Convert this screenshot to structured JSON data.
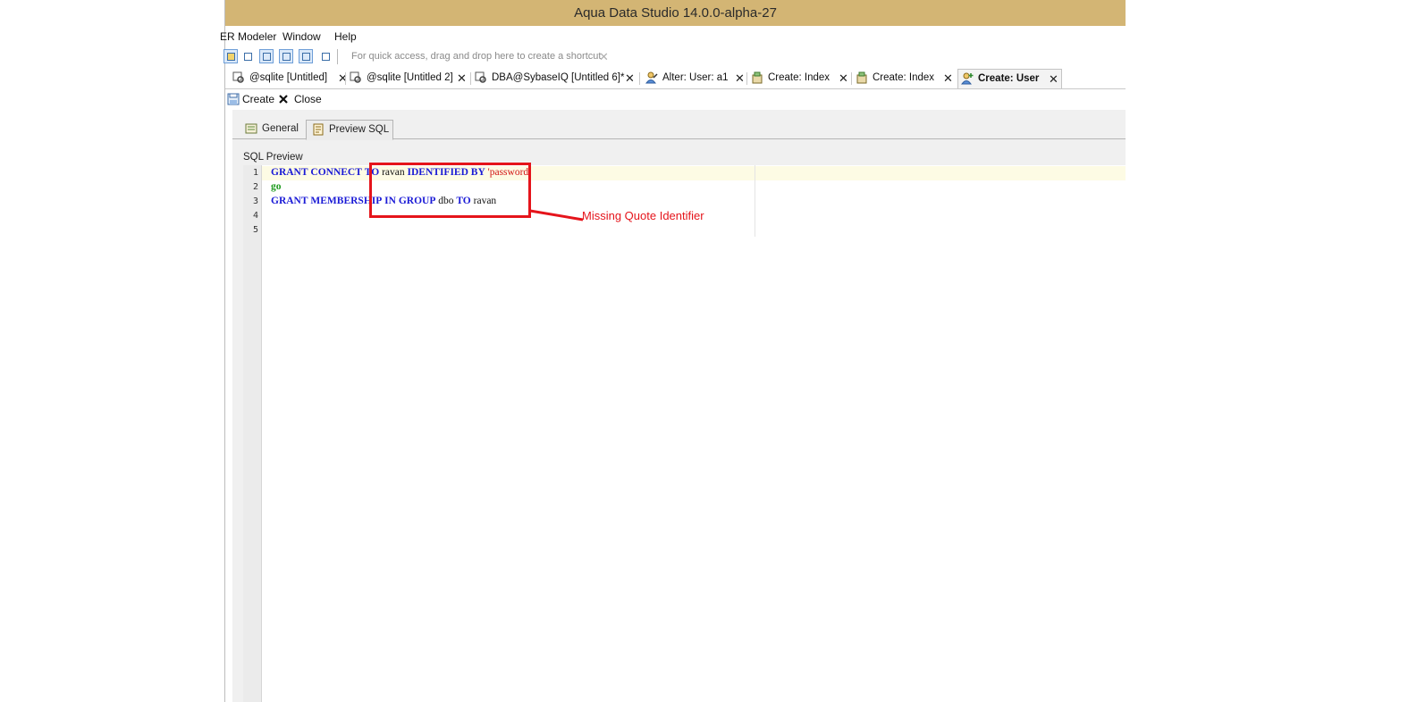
{
  "window": {
    "title": "Aqua Data Studio 14.0.0-alpha-27"
  },
  "menu": {
    "items": [
      "ER Modeler",
      "Window",
      "Help"
    ]
  },
  "toolbar": {
    "shortcut_hint": "For quick access, drag and drop here to create a shortcut",
    "hint_close": "✕"
  },
  "tabs": [
    {
      "label": "@sqlite [Untitled]",
      "icon": "query-icon",
      "close": "✕"
    },
    {
      "label": "@sqlite [Untitled 2]",
      "icon": "query-icon",
      "close": "✕"
    },
    {
      "label": "DBA@SybaseIQ [Untitled 6]*",
      "icon": "query-icon",
      "close": "✕"
    },
    {
      "label": "Alter: User: a1",
      "icon": "user-icon",
      "close": "✕"
    },
    {
      "label": "Create: Index",
      "icon": "index-icon",
      "close": "✕"
    },
    {
      "label": "Create: Index",
      "icon": "index-icon",
      "close": "✕"
    },
    {
      "label": "Create: User",
      "icon": "add-user-icon",
      "close": "✕",
      "active": true
    }
  ],
  "actions": {
    "create": "Create",
    "close": "Close"
  },
  "subtabs": {
    "general": "General",
    "preview_sql": "Preview SQL",
    "active": "preview_sql"
  },
  "preview": {
    "section_label": "SQL Preview",
    "line_numbers": [
      "1",
      "2",
      "3",
      "4",
      "5"
    ],
    "line1": {
      "kw1": "GRANT",
      "kw2": "CONNECT",
      "kw3": "TO",
      "user": "ravan",
      "kw4": "IDENTIFIED",
      "kw5": "BY",
      "pwd": "'password'"
    },
    "line2": {
      "kw": "go"
    },
    "line3": {
      "kw1": "GRANT",
      "kw2": "MEMBERSHIP",
      "kw3": "IN",
      "kw4": "GROUP",
      "grp": "dbo",
      "kw5": "TO",
      "user": "ravan"
    }
  },
  "annotation": {
    "text": "Missing Quote Identifier",
    "color": "#e5141b"
  },
  "colors": {
    "titlebar": "#d3b574",
    "keyword": "#1a1ad6",
    "string": "#d21414",
    "go_keyword": "#1d9a1d"
  }
}
